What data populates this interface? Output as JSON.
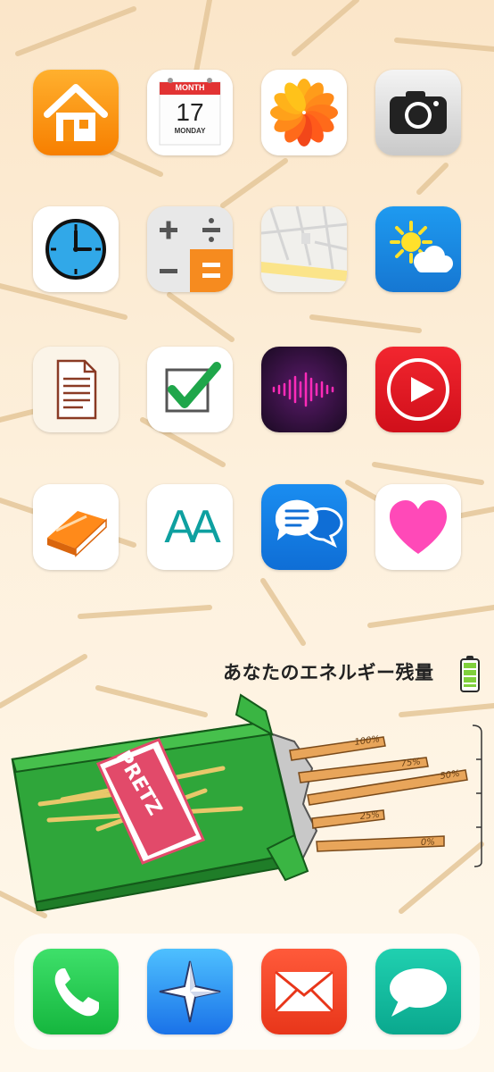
{
  "home_screen": {
    "apps": [
      {
        "name": "home-app",
        "icon": "house-icon"
      },
      {
        "name": "calendar-app",
        "icon": "calendar-icon",
        "month_label": "MONTH",
        "day": "17",
        "weekday": "MONDAY"
      },
      {
        "name": "photos-app",
        "icon": "flower-icon"
      },
      {
        "name": "camera-app",
        "icon": "camera-icon"
      },
      {
        "name": "clock-app",
        "icon": "clock-icon"
      },
      {
        "name": "calculator-app",
        "icon": "calculator-icon"
      },
      {
        "name": "maps-app",
        "icon": "map-icon"
      },
      {
        "name": "weather-app",
        "icon": "sun-cloud-icon"
      },
      {
        "name": "notes-app",
        "icon": "document-icon"
      },
      {
        "name": "tasks-app",
        "icon": "checkmark-icon"
      },
      {
        "name": "voice-memos-app",
        "icon": "waveform-icon"
      },
      {
        "name": "video-app",
        "icon": "play-icon"
      },
      {
        "name": "books-app",
        "icon": "book-icon"
      },
      {
        "name": "fonts-app",
        "icon": "letters-icon",
        "letters": "AA"
      },
      {
        "name": "chat-app",
        "icon": "speech-bubbles-icon"
      },
      {
        "name": "health-app",
        "icon": "heart-icon"
      }
    ],
    "dock": [
      {
        "name": "phone-app",
        "icon": "phone-icon"
      },
      {
        "name": "compass-app",
        "icon": "compass-icon"
      },
      {
        "name": "mail-app",
        "icon": "envelope-icon"
      },
      {
        "name": "messages-app",
        "icon": "message-bubble-icon"
      }
    ]
  },
  "energy_widget": {
    "title": "あなたのエネルギー残量",
    "battery_level": 1.0,
    "battery_color": "#7fd03c",
    "box_brand": "PRETZ",
    "stick_labels": [
      "100%",
      "75%",
      "50%",
      "25%",
      "0%"
    ]
  },
  "colors": {
    "background_top": "#fbe6c9",
    "pretz_box_green": "#2fa63a",
    "pretz_label_pink": "#e24a6a"
  }
}
